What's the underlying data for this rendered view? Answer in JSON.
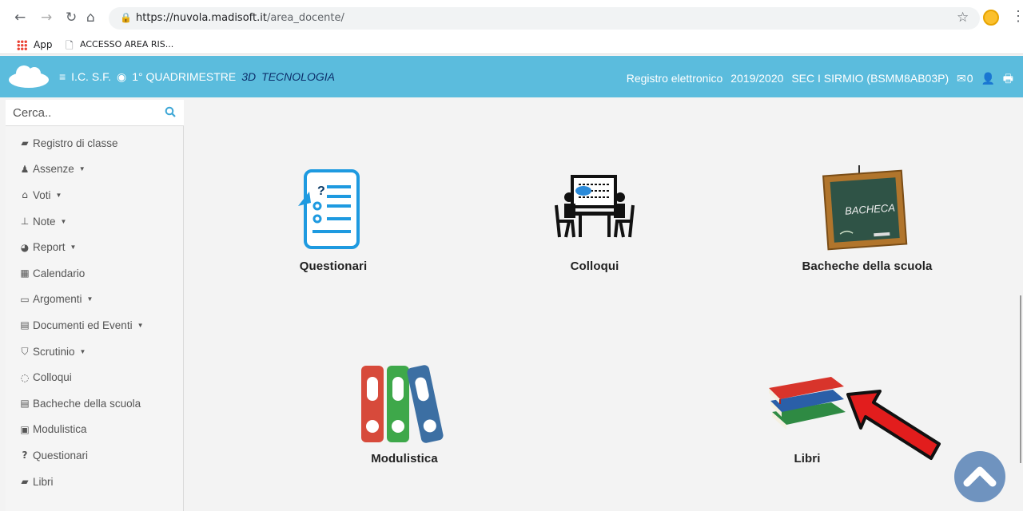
{
  "browser": {
    "url_host": "https://nuvola.madisoft.it",
    "url_path": "/area_docente/",
    "back_icon": "arrow-left-icon",
    "forward_icon": "arrow-right-icon",
    "reload_icon": "reload-icon",
    "home_icon": "home-icon"
  },
  "bookmarks": {
    "apps_label": "App",
    "item_label": "ACCESSO AREA RIS..."
  },
  "header": {
    "school": "I.C. S.F.",
    "period": "1° QUADRIMESTRE",
    "class": "3D",
    "subject": "TECNOLOGIA",
    "register": "Registro elettronico",
    "year": "2019/2020",
    "section": "SEC I SIRMIO (BSMM8AB03P)",
    "mail_count": "0",
    "bg_color": "#5bbcdd"
  },
  "sidebar": {
    "search_placeholder": "Cerca..",
    "items": [
      {
        "label": "Registro di classe",
        "icon": "book-icon",
        "dropdown": false
      },
      {
        "label": "Assenze",
        "icon": "user-icon",
        "dropdown": true
      },
      {
        "label": "Voti",
        "icon": "institution-icon",
        "dropdown": true
      },
      {
        "label": "Note",
        "icon": "pin-icon",
        "dropdown": true
      },
      {
        "label": "Report",
        "icon": "pie-chart-icon",
        "dropdown": true
      },
      {
        "label": "Calendario",
        "icon": "calendar-icon",
        "dropdown": false
      },
      {
        "label": "Argomenti",
        "icon": "folder-open-icon",
        "dropdown": true
      },
      {
        "label": "Documenti ed Eventi",
        "icon": "archive-icon",
        "dropdown": true
      },
      {
        "label": "Scrutinio",
        "icon": "graduation-cap-icon",
        "dropdown": true
      },
      {
        "label": "Colloqui",
        "icon": "comments-icon",
        "dropdown": false
      },
      {
        "label": "Bacheche della scuola",
        "icon": "list-alt-icon",
        "dropdown": false
      },
      {
        "label": "Modulistica",
        "icon": "file-archive-icon",
        "dropdown": false
      },
      {
        "label": "Questionari",
        "icon": "question-icon",
        "dropdown": false
      },
      {
        "label": "Libri",
        "icon": "book-icon",
        "dropdown": false
      }
    ]
  },
  "tiles": {
    "questionari": "Questionari",
    "colloqui": "Colloqui",
    "bacheche": "Bacheche della scuola",
    "board_text": "BACHECA",
    "modulistica": "Modulistica",
    "libri": "Libri"
  }
}
